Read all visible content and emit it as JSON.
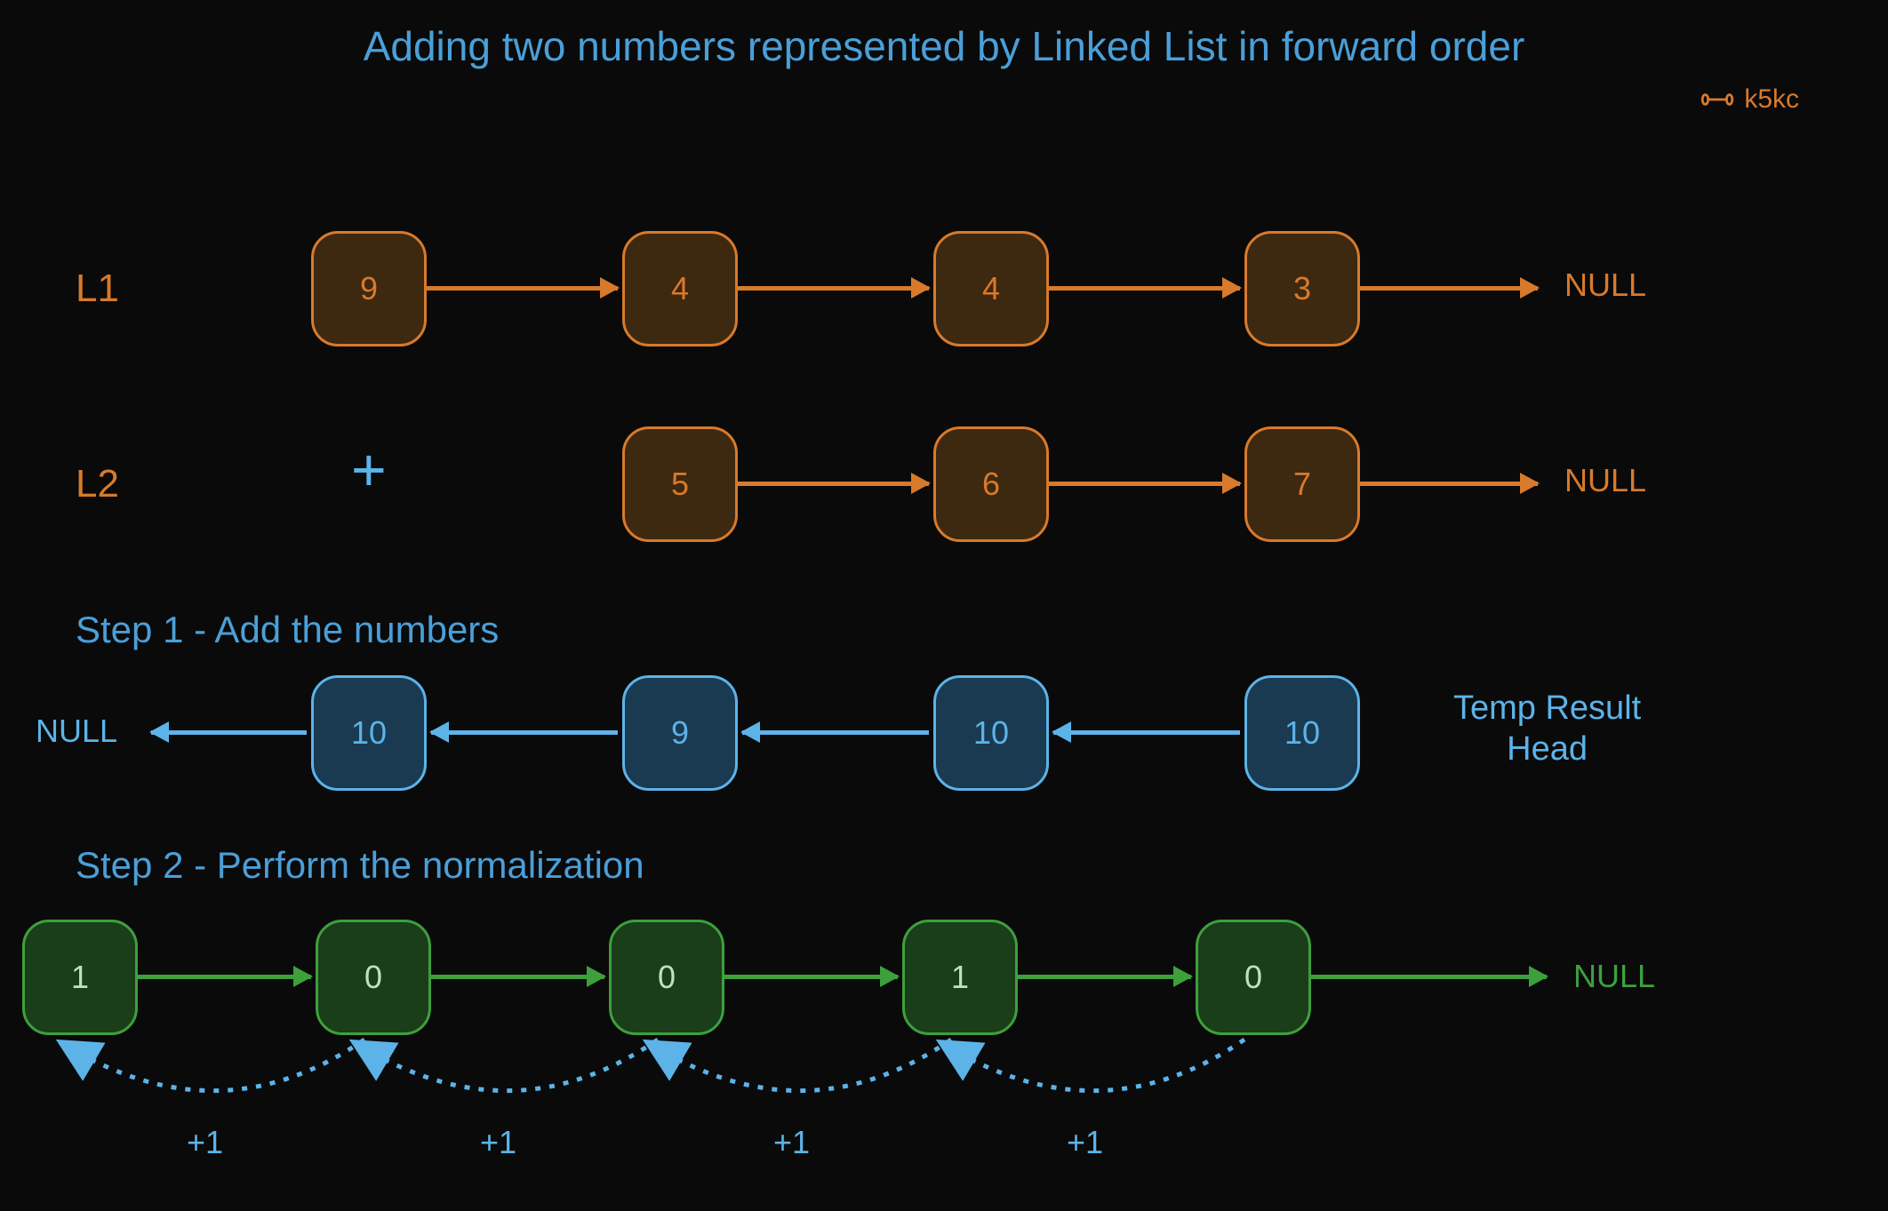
{
  "title": "Adding two numbers represented by Linked List in forward order",
  "brand": "k5kc",
  "labels": {
    "l1": "L1",
    "l2": "L2",
    "plus": "+",
    "null": "NULL",
    "step1": "Step 1 - Add the numbers",
    "step2": "Step 2 - Perform the normalization",
    "temp_result": "Temp Result\nHead"
  },
  "lists": {
    "l1": [
      "9",
      "4",
      "4",
      "3"
    ],
    "l2": [
      "5",
      "6",
      "7"
    ],
    "temp": [
      "10",
      "9",
      "10",
      "10"
    ],
    "final": [
      "1",
      "0",
      "0",
      "1",
      "0"
    ]
  },
  "carries": [
    "+1",
    "+1",
    "+1",
    "+1"
  ],
  "colors": {
    "orange": "#d87a2b",
    "blue": "#5cb3e8",
    "green": "#3da03d"
  }
}
